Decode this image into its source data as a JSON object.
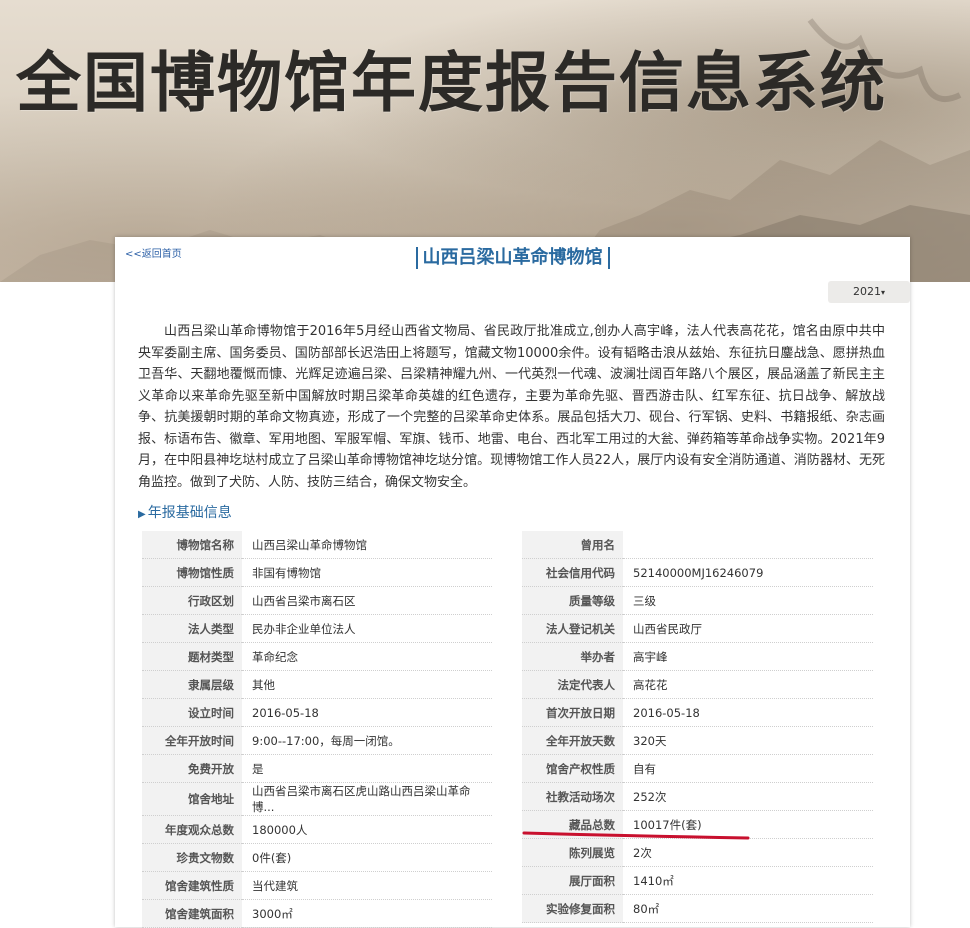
{
  "header": {
    "system_title": "全国博物馆年度报告信息系统"
  },
  "nav": {
    "back_label": "<<返回首页"
  },
  "museum": {
    "name": "山西吕梁山革命博物馆"
  },
  "year_select": {
    "value": "2021"
  },
  "intro": "山西吕梁山革命博物馆于2016年5月经山西省文物局、省民政厅批准成立,创办人高宇峰，法人代表高花花，馆名由原中共中央军委副主席、国务委员、国防部部长迟浩田上将题写，馆藏文物10000余件。设有韬略击浪从兹始、东征抗日鏖战急、愿拼热血卫吾华、天翻地覆慨而慷、光辉足迹遍吕梁、吕梁精神耀九州、一代英烈一代魂、波澜壮阔百年路八个展区，展品涵盖了新民主主义革命以来革命先驱至新中国解放时期吕梁革命英雄的红色遗存，主要为革命先驱、晋西游击队、红军东征、抗日战争、解放战争、抗美援朝时期的革命文物真迹，形成了一个完整的吕梁革命史体系。展品包括大刀、砚台、行军锅、史料、书籍报纸、杂志画报、标语布告、徽章、军用地图、军服军帽、军旗、钱币、地雷、电台、西北军工用过的大瓮、弹药箱等革命战争实物。2021年9月，在中阳县神圪垯村成立了吕梁山革命博物馆神圪垯分馆。现博物馆工作人员22人，展厅内设有安全消防通道、消防器材、无死角监控。做到了犬防、人防、技防三结合，确保文物安全。",
  "section": {
    "title": "年报基础信息"
  },
  "left_rows": [
    {
      "label": "博物馆名称",
      "value": "山西吕梁山革命博物馆"
    },
    {
      "label": "博物馆性质",
      "value": "非国有博物馆"
    },
    {
      "label": "行政区划",
      "value": "山西省吕梁市离石区"
    },
    {
      "label": "法人类型",
      "value": "民办非企业单位法人"
    },
    {
      "label": "题材类型",
      "value": "革命纪念"
    },
    {
      "label": "隶属层级",
      "value": "其他"
    },
    {
      "label": "设立时间",
      "value": "2016-05-18"
    },
    {
      "label": "全年开放时间",
      "value": "9:00--17:00，每周一闭馆。"
    },
    {
      "label": "免费开放",
      "value": "是"
    },
    {
      "label": "馆舍地址",
      "value": "山西省吕梁市离石区虎山路山西吕梁山革命博..."
    },
    {
      "label": "年度观众总数",
      "value": "180000人"
    },
    {
      "label": "珍贵文物数",
      "value": "0件(套)"
    },
    {
      "label": "馆舍建筑性质",
      "value": "当代建筑"
    },
    {
      "label": "馆舍建筑面积",
      "value": "3000㎡"
    }
  ],
  "right_rows": [
    {
      "label": "曾用名",
      "value": ""
    },
    {
      "label": "社会信用代码",
      "value": "52140000MJ16246079"
    },
    {
      "label": "质量等级",
      "value": "三级"
    },
    {
      "label": "法人登记机关",
      "value": "山西省民政厅"
    },
    {
      "label": "举办者",
      "value": "高宇峰"
    },
    {
      "label": "法定代表人",
      "value": "高花花"
    },
    {
      "label": "首次开放日期",
      "value": "2016-05-18"
    },
    {
      "label": "全年开放天数",
      "value": "320天"
    },
    {
      "label": "馆舍产权性质",
      "value": "自有"
    },
    {
      "label": "社教活动场次",
      "value": "252次"
    },
    {
      "label": "藏品总数",
      "value": "10017件(套)"
    },
    {
      "label": "陈列展览",
      "value": "2次"
    },
    {
      "label": "展厅面积",
      "value": "1410㎡"
    },
    {
      "label": "实验修复面积",
      "value": "80㎡"
    }
  ],
  "highlight_color": "#c8102e",
  "accent_color": "#2a6aa0"
}
